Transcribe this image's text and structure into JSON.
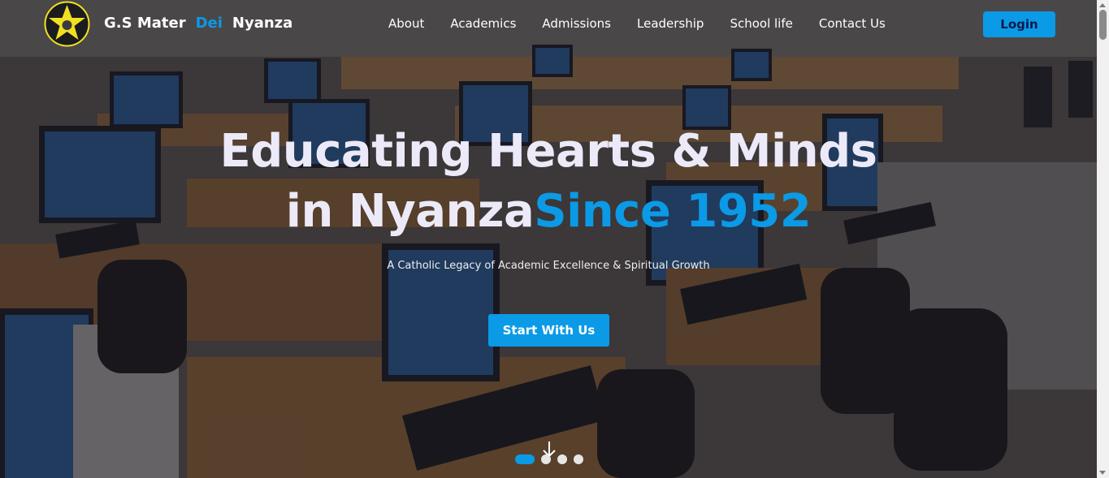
{
  "brand": {
    "name_part1": "G.S Mater",
    "name_part2": "Dei",
    "name_part3": "Nyanza",
    "logo_icon": "star-emblem-icon"
  },
  "nav": {
    "items": [
      {
        "label": "About"
      },
      {
        "label": "Academics"
      },
      {
        "label": "Admissions"
      },
      {
        "label": "Leadership"
      },
      {
        "label": "School life"
      },
      {
        "label": "Contact Us"
      }
    ],
    "login_label": "Login"
  },
  "hero": {
    "title_line1": "Educating Hearts & Minds",
    "title_line2_a": "in Nyanza",
    "title_line2_b": "Since 1952",
    "subtitle": "A Catholic Legacy of Academic Excellence & Spiritual Growth",
    "cta_label": "Start With Us",
    "background": "computer-lab-photo",
    "scroll_icon": "arrow-down-icon",
    "carousel": {
      "total_slides": 4,
      "active_slide": 1
    }
  },
  "colors": {
    "accent": "#0b9ae6",
    "logo_yellow": "#f2e020",
    "text_light": "#eceaf8"
  }
}
